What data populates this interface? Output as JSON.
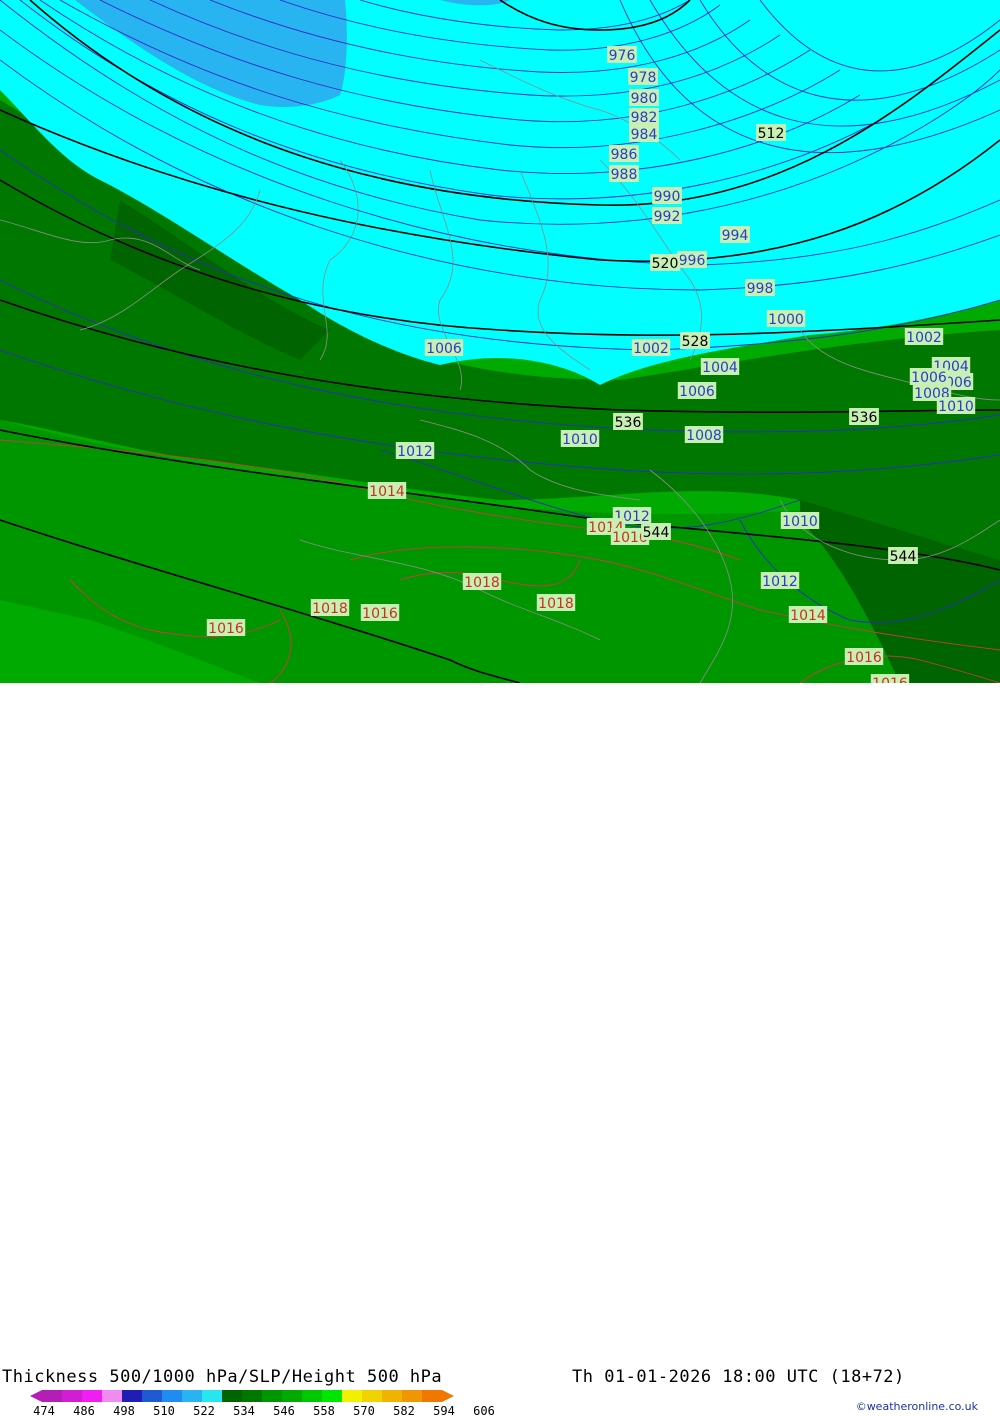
{
  "title_left": "Thickness 500/1000 hPa/SLP/Height 500 hPa",
  "title_right": "Th 01-01-2026 18:00 UTC (18+72)",
  "credit": "©weatheronline.co.uk",
  "colorbar": {
    "ticks": [
      "474",
      "486",
      "498",
      "510",
      "522",
      "534",
      "546",
      "558",
      "570",
      "582",
      "594",
      "606"
    ],
    "colors": [
      "#b41eb4",
      "#d21ed2",
      "#f01ef0",
      "#f08cf0",
      "#1e1eb4",
      "#1e5ad2",
      "#1e8cf0",
      "#28b4f0",
      "#28e6f0",
      "#006400",
      "#007800",
      "#009600",
      "#00aa00",
      "#00c800",
      "#00e600",
      "#f0f000",
      "#f0d200",
      "#f0b400",
      "#f09600",
      "#f07800"
    ]
  },
  "fill_colors": {
    "cyan": "#00ffff",
    "light_blue": "#28b4f0",
    "green_dark": "#006400",
    "green": "#007800",
    "green_mid": "#009600",
    "green_light": "#00aa00"
  },
  "labels": {
    "slp_blue": [
      "976",
      "978",
      "980",
      "982",
      "984",
      "986",
      "988",
      "990",
      "992",
      "994",
      "996",
      "998",
      "1000",
      "1002",
      "1002",
      "1004",
      "1004",
      "1006",
      "1006",
      "1006",
      "1008",
      "1008",
      "1010",
      "1010",
      "1010",
      "1012",
      "1012",
      "1012",
      "1006"
    ],
    "slp_red": [
      "1014",
      "1014",
      "1016",
      "1016",
      "1018",
      "1018",
      "1018",
      "1016",
      "1016",
      "1014",
      "1016"
    ],
    "height": [
      "512",
      "520",
      "528",
      "536",
      "536",
      "544",
      "544"
    ]
  }
}
